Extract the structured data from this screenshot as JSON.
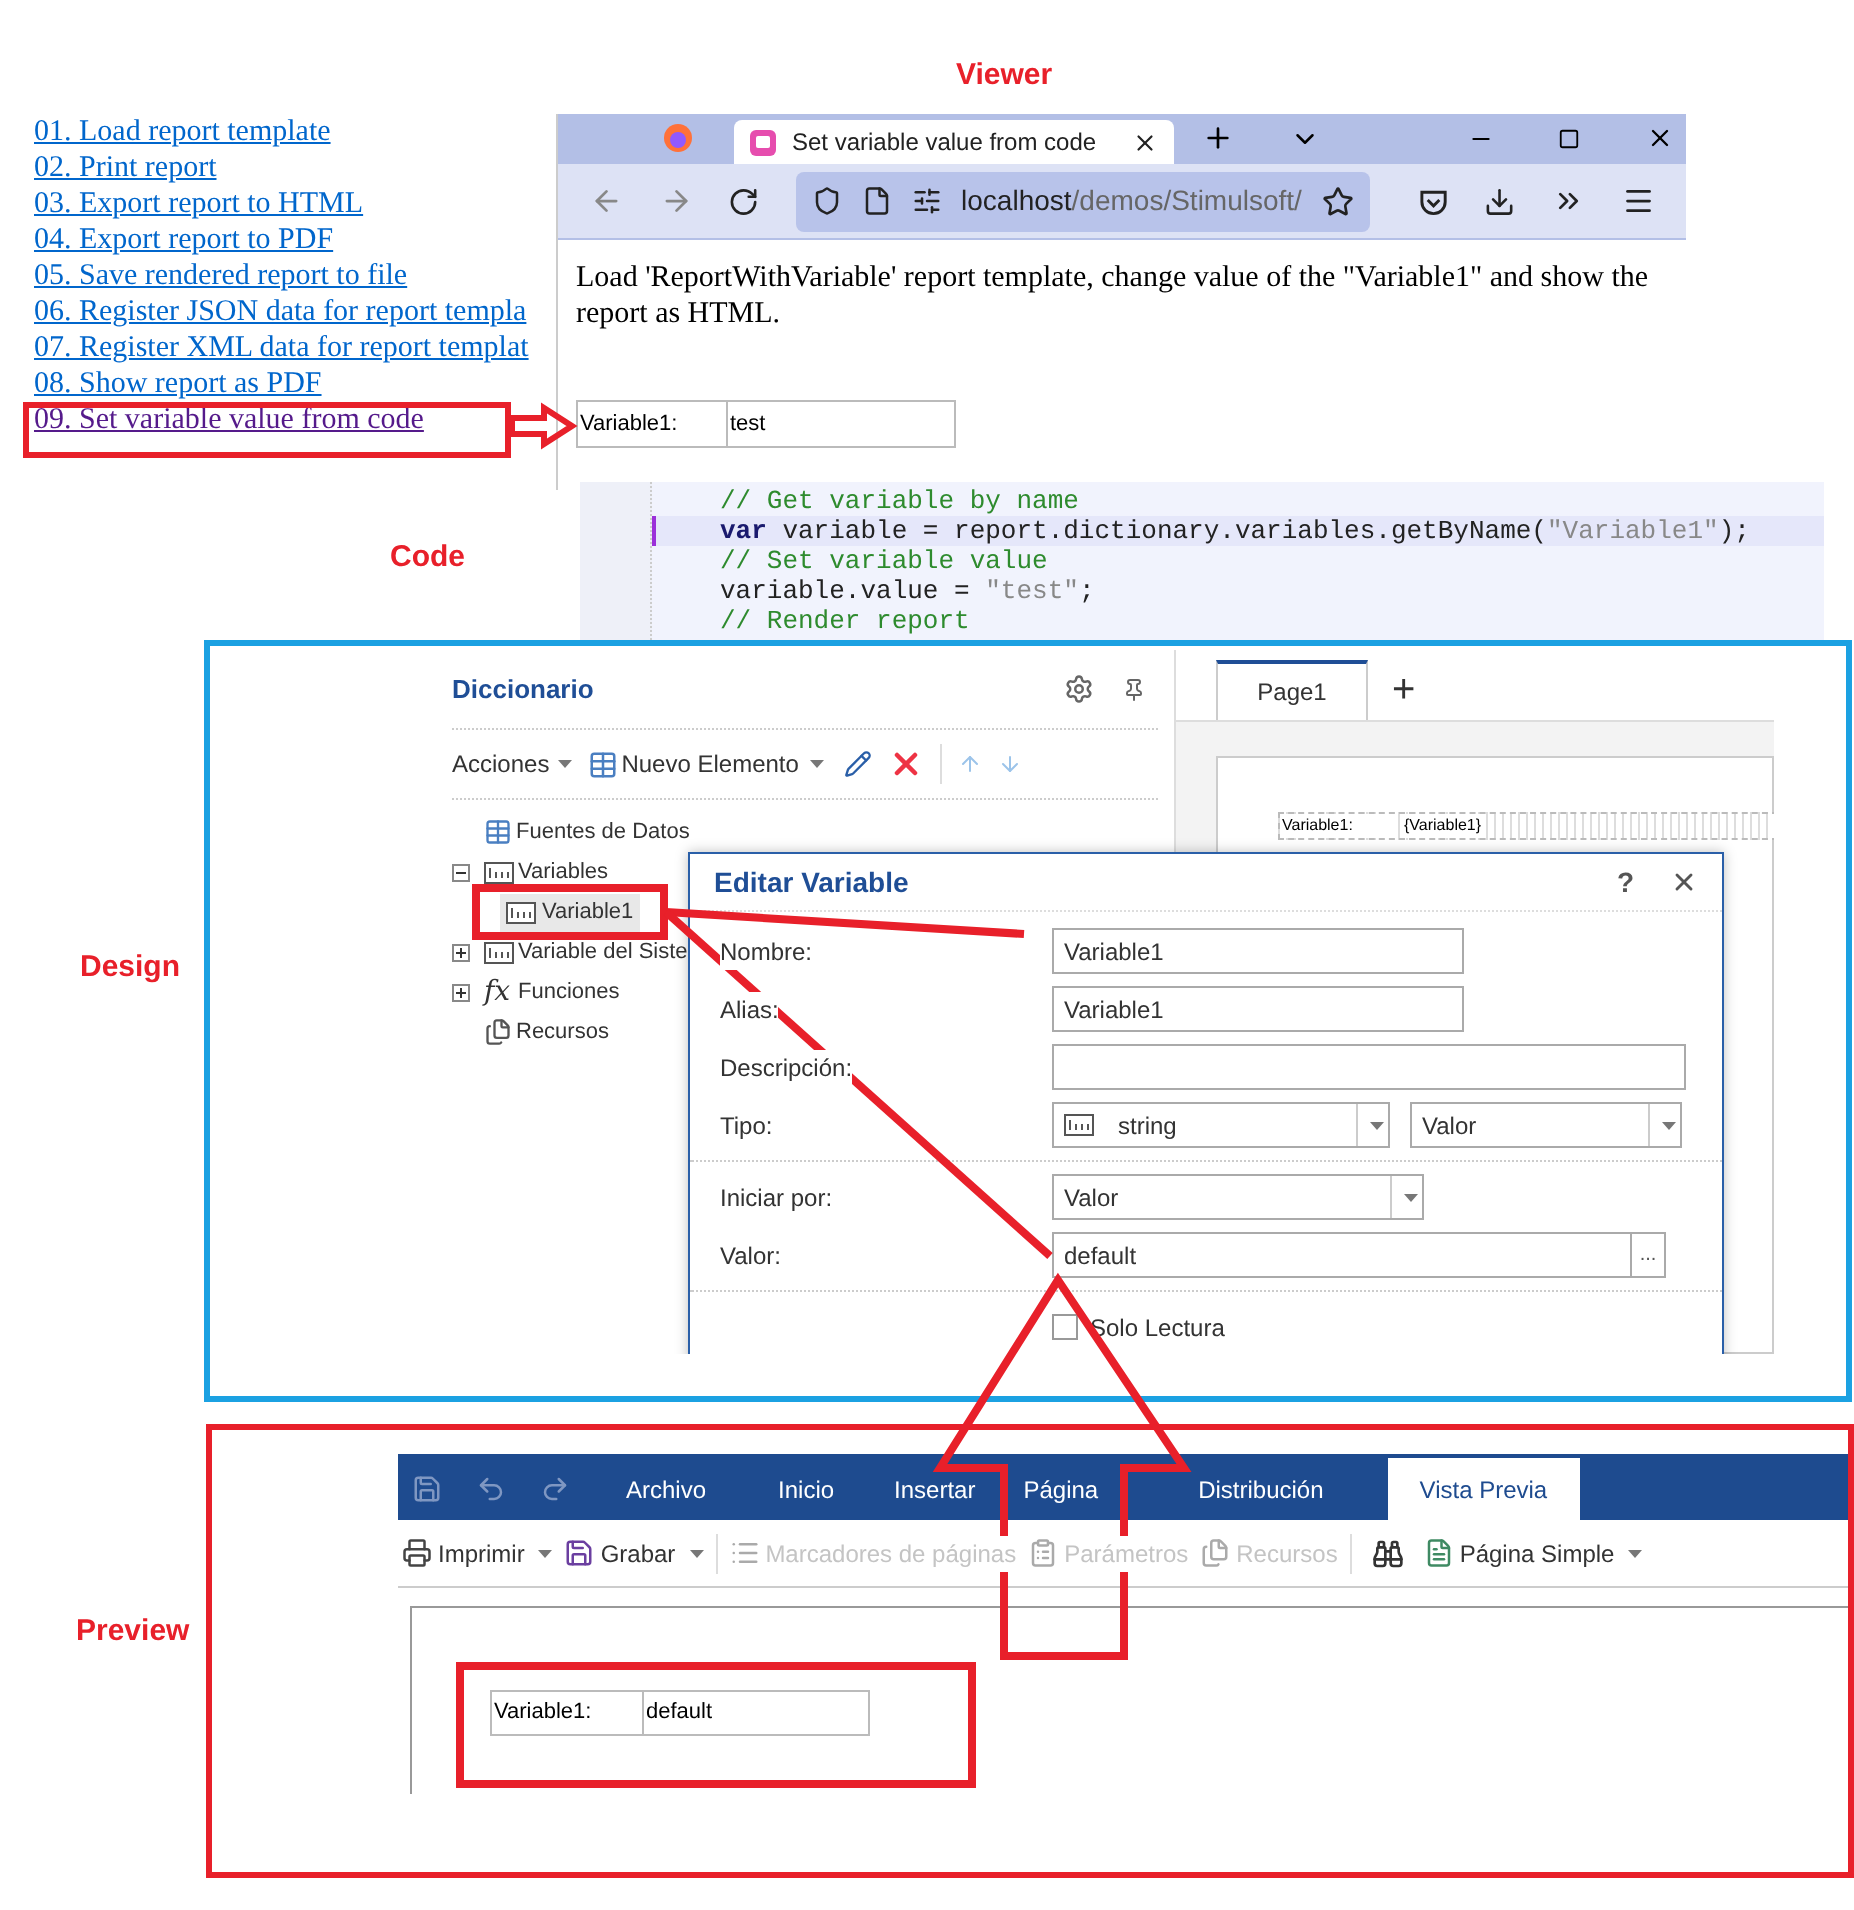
{
  "annotations": {
    "labels": [
      {
        "text": "Viewer"
      },
      {
        "text": "Code"
      },
      {
        "text": "Design"
      },
      {
        "text": "Preview"
      }
    ]
  },
  "examples_list": {
    "items": [
      {
        "label": "01. Load report template",
        "visited": false
      },
      {
        "label": "02. Print report",
        "visited": false
      },
      {
        "label": "03. Export report to HTML",
        "visited": false
      },
      {
        "label": "04. Export report to PDF",
        "visited": false
      },
      {
        "label": "05. Save rendered report to file",
        "visited": false
      },
      {
        "label": "06. Register JSON data for report templa",
        "visited": false
      },
      {
        "label": "07. Register XML data for report templat",
        "visited": false
      },
      {
        "label": "08. Show report as PDF",
        "visited": false
      },
      {
        "label": "09. Set variable value from code",
        "visited": true
      }
    ]
  },
  "browser": {
    "tab_title": "Set variable value from code",
    "address": {
      "host": "localhost",
      "path": "/demos/Stimulsoft/"
    },
    "description": "Load 'ReportWithVariable' report template, change value of the \"Variable1\" and show the report as HTML.",
    "report": {
      "label": "Variable1:",
      "value": "test"
    }
  },
  "code": {
    "lines": [
      {
        "highlighted": false,
        "tokens": [
          {
            "kind": "comment",
            "text": "// Get variable by name"
          }
        ]
      },
      {
        "highlighted": true,
        "tokens": [
          {
            "kind": "keyword",
            "text": "var"
          },
          {
            "kind": "plain",
            "text": " variable = report.dictionary.variables.getByName("
          },
          {
            "kind": "string",
            "text": "\"Variable1\""
          },
          {
            "kind": "plain",
            "text": ");"
          }
        ]
      },
      {
        "highlighted": false,
        "tokens": [
          {
            "kind": "comment",
            "text": "// Set variable value"
          }
        ]
      },
      {
        "highlighted": false,
        "tokens": [
          {
            "kind": "plain",
            "text": "variable.value = "
          },
          {
            "kind": "string",
            "text": "\"test\""
          },
          {
            "kind": "plain",
            "text": ";"
          }
        ]
      },
      {
        "highlighted": false,
        "tokens": [
          {
            "kind": "comment",
            "text": "// Render report"
          }
        ]
      }
    ]
  },
  "designer": {
    "dictionary": {
      "title": "Diccionario",
      "actions": "Acciones",
      "new_item": "Nuevo Elemento",
      "tree": [
        {
          "label": "Fuentes de Datos"
        },
        {
          "label": "Variables",
          "expanded": true,
          "children": [
            {
              "label": "Variable1",
              "selected": true
            }
          ]
        },
        {
          "label": "Variable del Siste",
          "expanded": false
        },
        {
          "label": "Funciones",
          "icon_text": "fx",
          "expanded": false
        },
        {
          "label": "Recursos"
        }
      ]
    },
    "page_tabs": [
      {
        "label": "Page1",
        "selected": true
      }
    ],
    "add_page": "+",
    "page_component": {
      "label": "Variable1:",
      "value": "{Variable1}"
    },
    "dialog": {
      "title": "Editar Variable",
      "help": "?",
      "fields": [
        {
          "kind": "text",
          "label": "Nombre:",
          "value": "Variable1"
        },
        {
          "kind": "text",
          "label": "Alias:",
          "value": "Variable1"
        },
        {
          "kind": "wide",
          "label": "Descripción:"
        },
        {
          "kind": "type",
          "label": "Tipo:",
          "value": "string",
          "mode": "Valor"
        },
        {
          "kind": "divider"
        },
        {
          "kind": "select",
          "label": "Iniciar por:",
          "value": "Valor"
        },
        {
          "kind": "browse",
          "label": "Valor:",
          "value": "default",
          "button": "..."
        },
        {
          "kind": "divider"
        },
        {
          "kind": "checkbox",
          "label": "Solo Lectura",
          "checked": false
        }
      ]
    }
  },
  "preview": {
    "ribbon_tabs": [
      {
        "label": "Archivo",
        "selected": false
      },
      {
        "label": "Inicio",
        "selected": false
      },
      {
        "label": "Insertar",
        "selected": false
      },
      {
        "label": "Página",
        "selected": false
      },
      {
        "label": "Distribución",
        "selected": false
      },
      {
        "label": "Vista Previa",
        "selected": true
      }
    ],
    "toolbar": [
      {
        "kind": "button",
        "label": "Imprimir",
        "dropdown": true,
        "disabled": false
      },
      {
        "kind": "button",
        "label": "Grabar",
        "dropdown": true,
        "disabled": false
      },
      {
        "kind": "separator"
      },
      {
        "kind": "button",
        "label": "Marcadores de páginas",
        "dropdown": false,
        "disabled": true
      },
      {
        "kind": "button",
        "label": "Parámetros",
        "dropdown": false,
        "disabled": true
      },
      {
        "kind": "button",
        "label": "Recursos",
        "dropdown": false,
        "disabled": true
      },
      {
        "kind": "separator"
      },
      {
        "kind": "icon"
      },
      {
        "kind": "button",
        "label": "Página Simple",
        "dropdown": true,
        "disabled": false
      }
    ],
    "report": {
      "label": "Variable1:",
      "value": "default"
    }
  }
}
